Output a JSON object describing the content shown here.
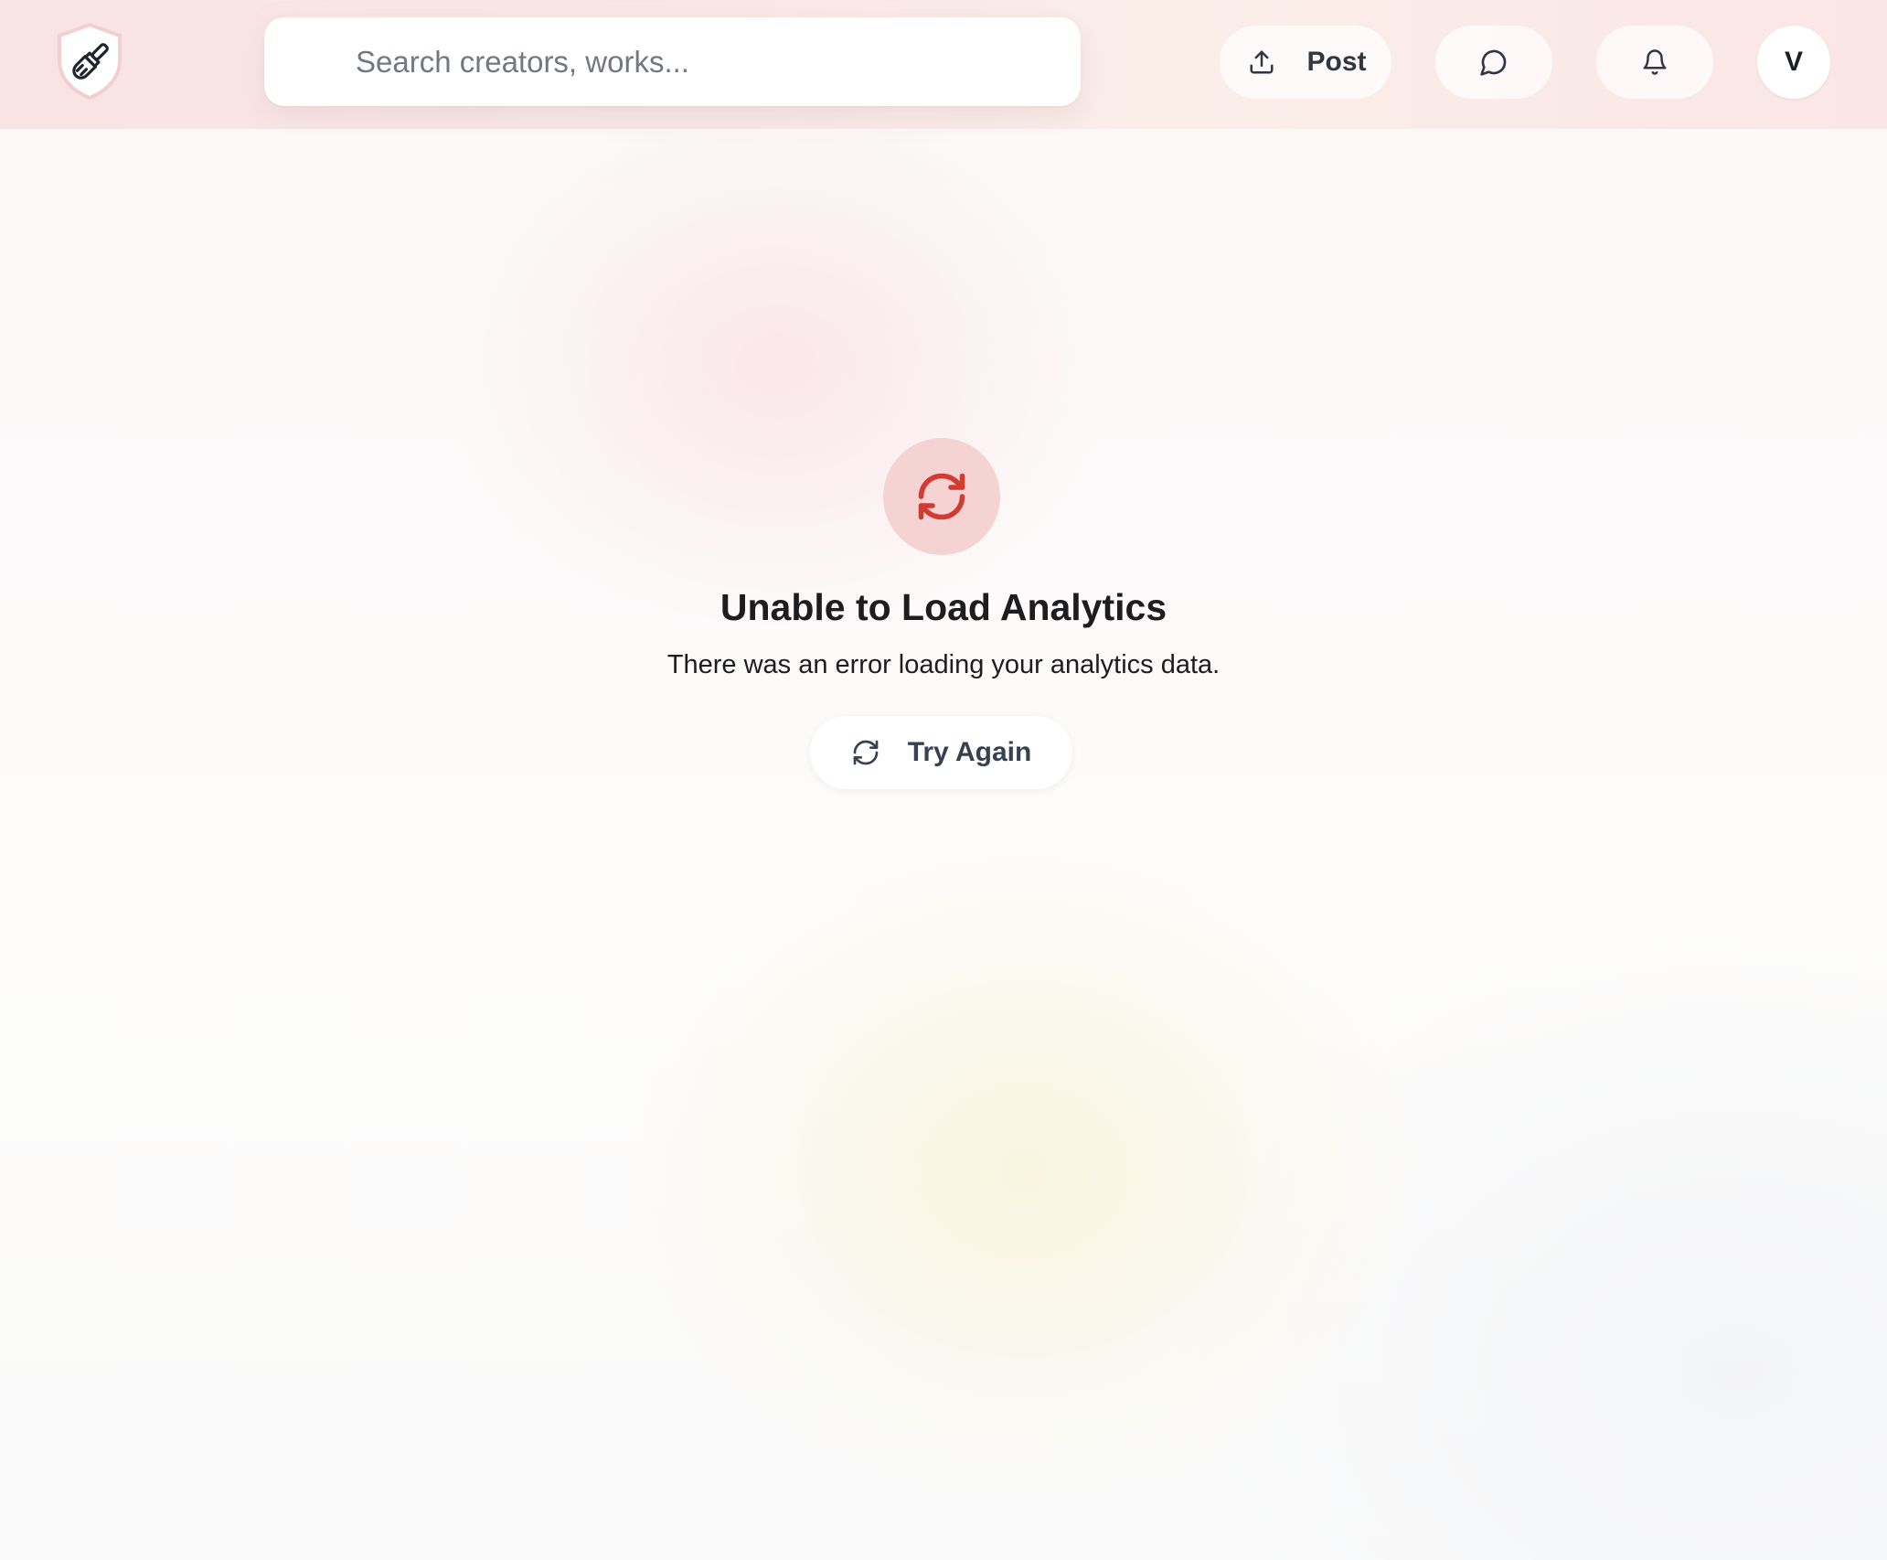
{
  "header": {
    "logo_icon": "paintbrush-shield-icon",
    "search": {
      "placeholder": "Search creators, works...",
      "value": ""
    },
    "post_button": {
      "label": "Post",
      "icon": "upload-icon"
    },
    "messages_button": {
      "icon": "message-circle-icon"
    },
    "notifications_button": {
      "icon": "bell-icon"
    },
    "avatar": {
      "initial": "V"
    }
  },
  "error_state": {
    "icon": "refresh-icon",
    "title": "Unable to Load Analytics",
    "description": "There was an error loading your analytics data.",
    "retry_button": {
      "label": "Try Again",
      "icon": "refresh-icon"
    }
  },
  "colors": {
    "error_accent": "#d33a32",
    "error_circle_bg": "#f6d3d3",
    "header_bg": "#f9e4e4",
    "text_primary": "#1d1d1f",
    "button_text": "#374151"
  }
}
